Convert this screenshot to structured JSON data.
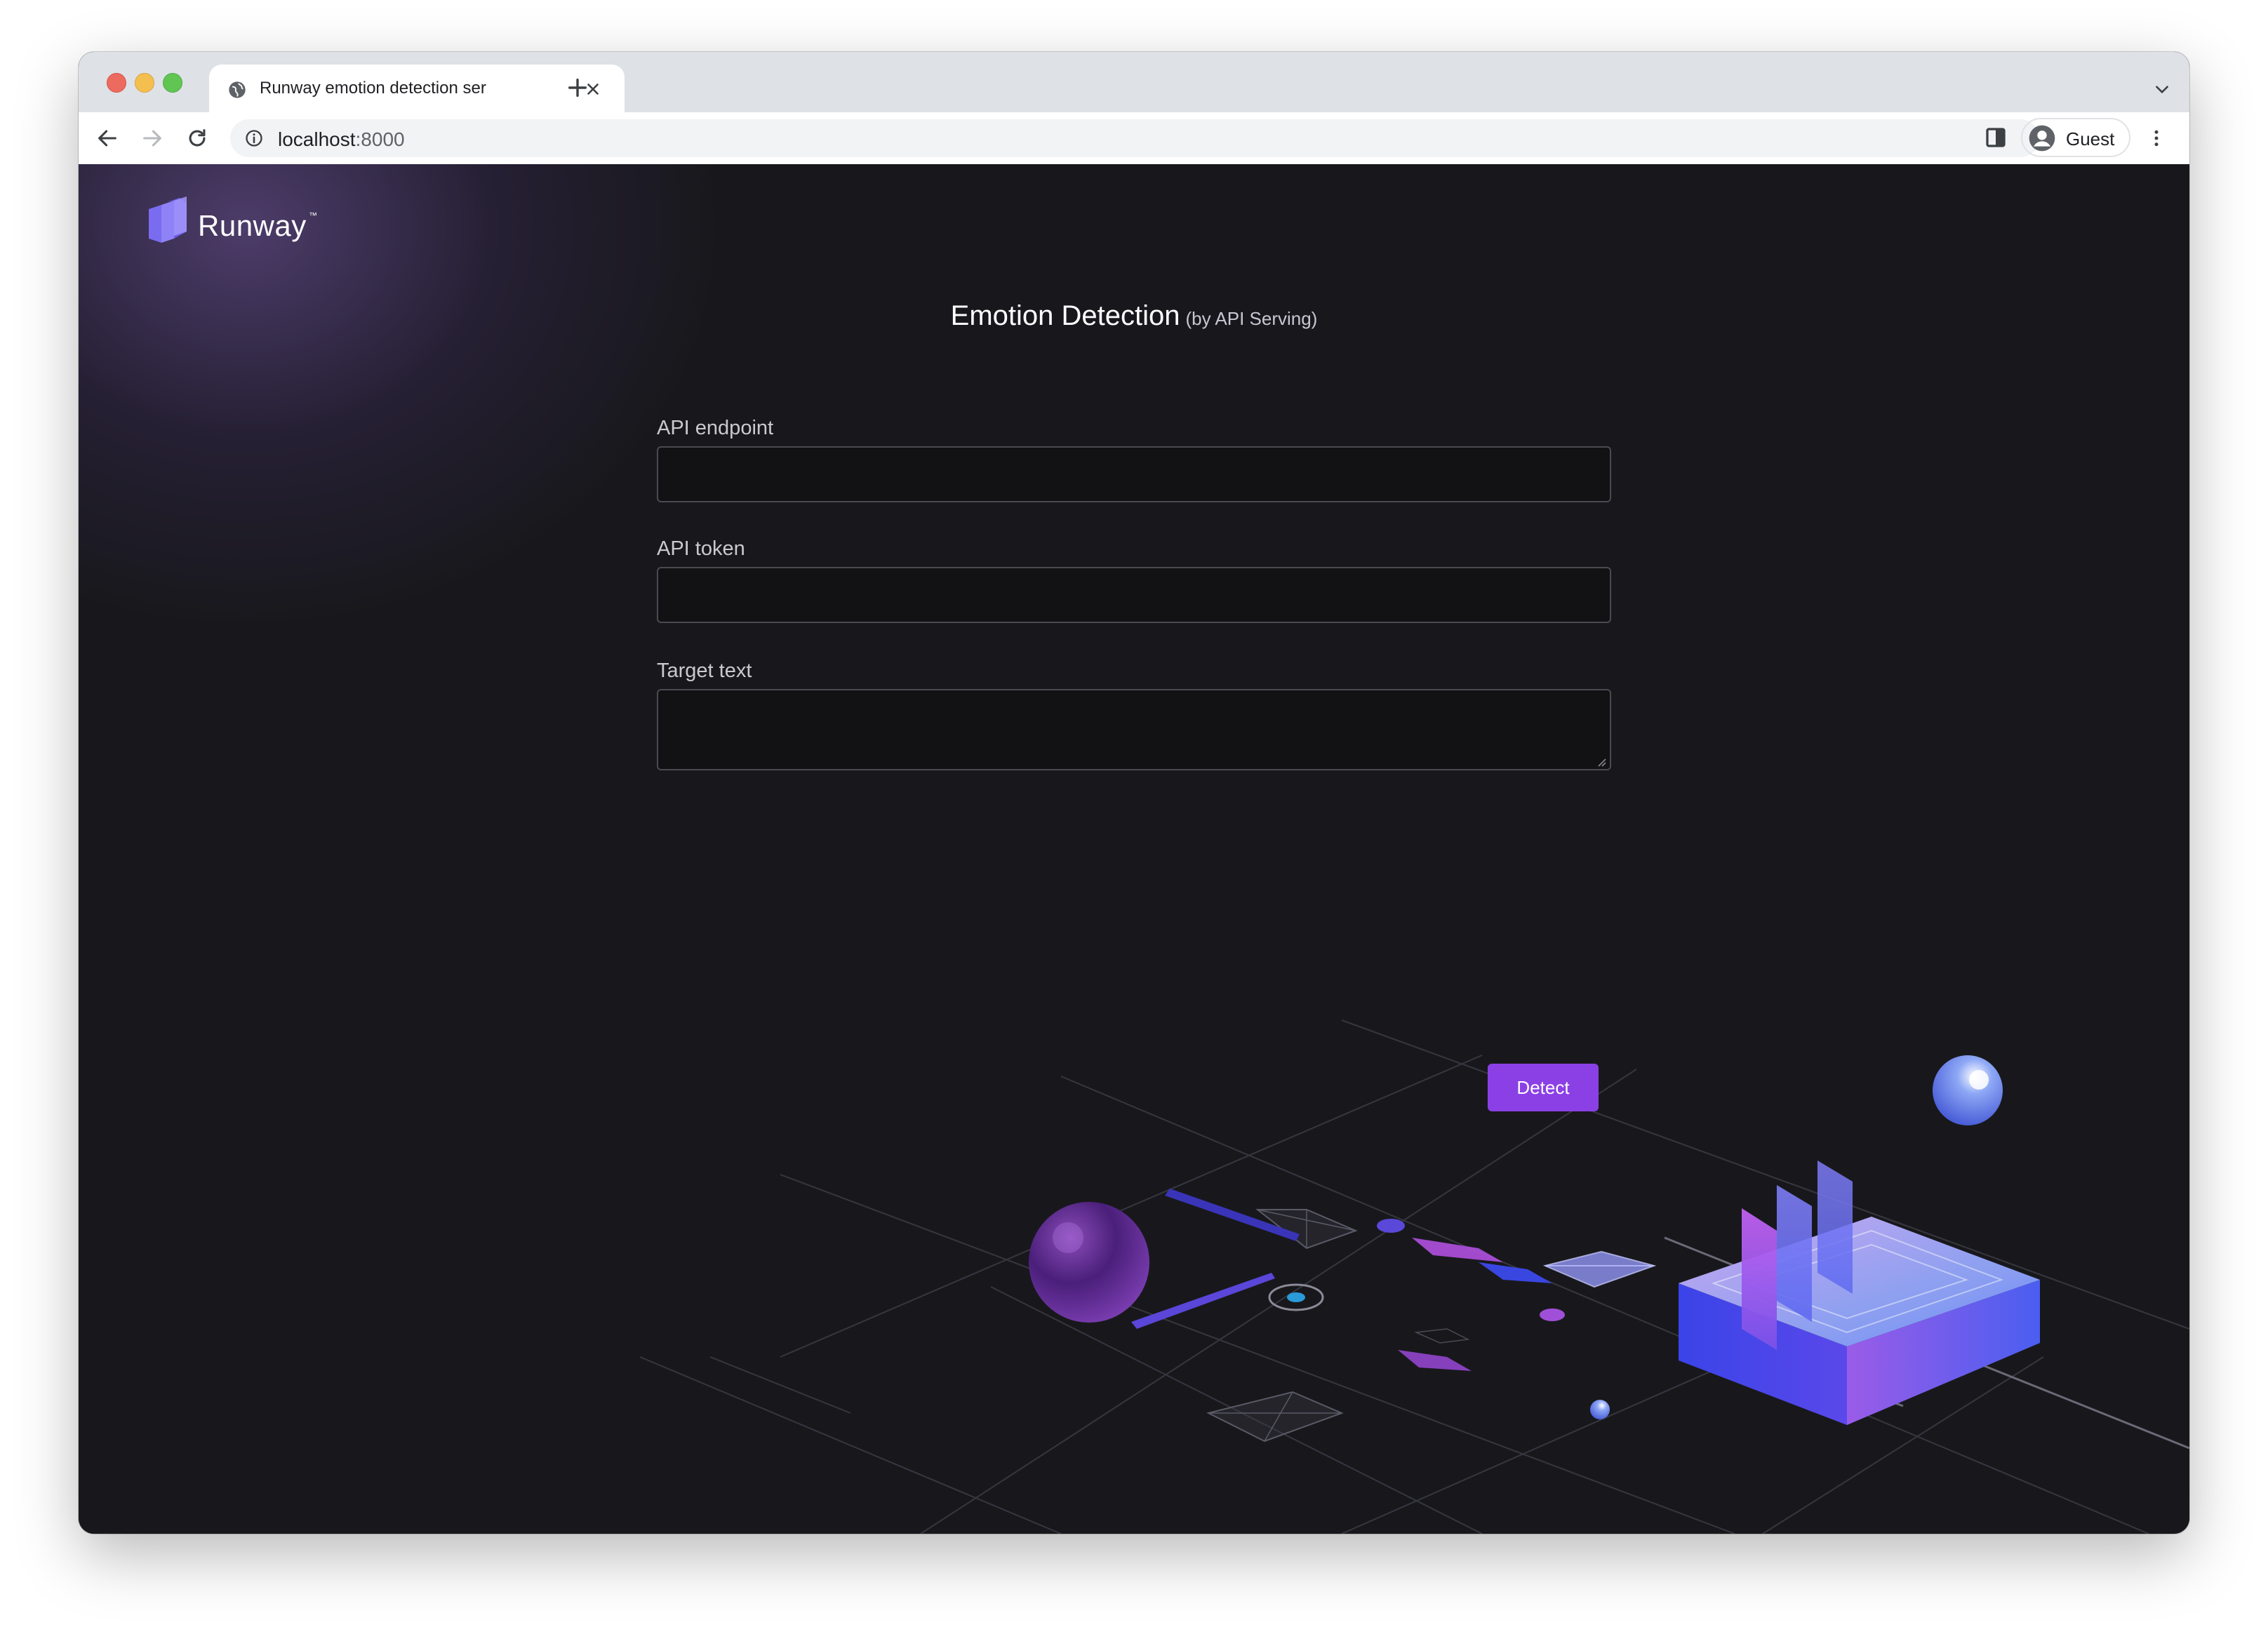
{
  "browser": {
    "tab_title": "Runway emotion detection ser",
    "url_host": "localhost",
    "url_port": ":8000",
    "profile_name": "Guest"
  },
  "app": {
    "logo_text": "Runway",
    "logo_tm": "™",
    "title": "Emotion Detection",
    "subtitle": "(by API Serving)"
  },
  "form": {
    "api_endpoint_label": "API endpoint",
    "api_endpoint_value": "",
    "api_token_label": "API token",
    "api_token_value": "",
    "target_text_label": "Target text",
    "target_text_value": "",
    "detect_button": "Detect"
  },
  "colors": {
    "accent": "#8b40e5",
    "page_background": "#18181c",
    "field_border": "#4a4a52"
  }
}
